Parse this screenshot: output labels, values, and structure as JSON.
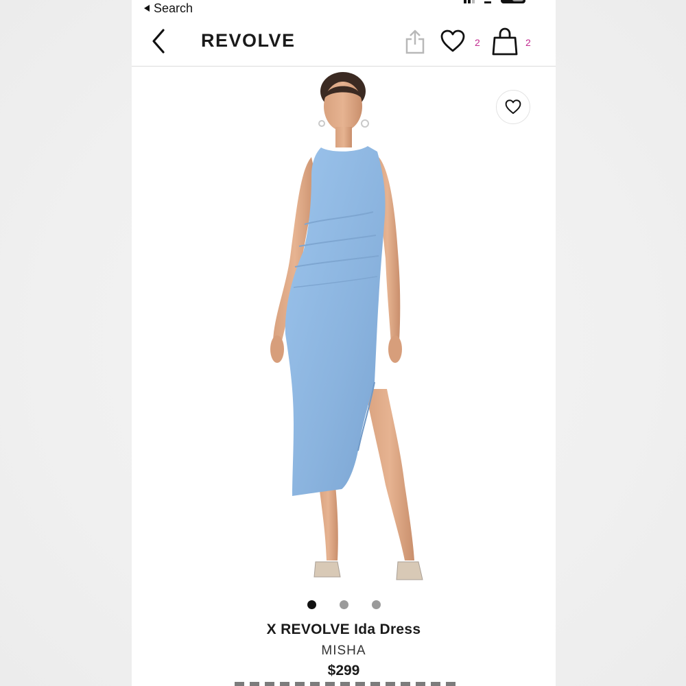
{
  "status_bar": {
    "back_label": "Search"
  },
  "header": {
    "logo": "REVOLVE",
    "wishlist_count": "2",
    "bag_count": "2"
  },
  "product": {
    "name": "X REVOLVE Ida Dress",
    "brand": "MISHA",
    "price": "$299",
    "image_count": 3,
    "active_image": 1
  },
  "colors": {
    "accent_badge": "#c2298f",
    "dress": "#8fb8e3"
  }
}
